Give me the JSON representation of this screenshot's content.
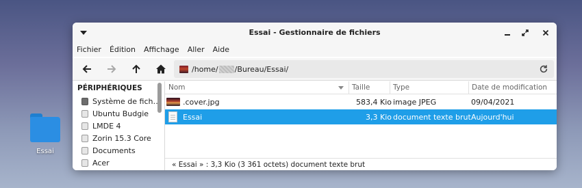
{
  "desktop": {
    "icon_label": "Essai"
  },
  "window": {
    "title": "Essai - Gestionnaire de fichiers"
  },
  "menu": [
    "Fichier",
    "Édition",
    "Affichage",
    "Aller",
    "Aide"
  ],
  "toolbar": {
    "back_icon": "arrow-left-icon",
    "forward_icon": "arrow-right-icon",
    "up_icon": "arrow-up-icon",
    "home_icon": "home-icon"
  },
  "location": {
    "path_prefix": "/home/",
    "path_suffix": "/Bureau/Essai/"
  },
  "sidebar": {
    "header": "PÉRIPHÉRIQUES",
    "items": [
      {
        "label": "Système de fich…",
        "icon": "system-drive-icon"
      },
      {
        "label": "Ubuntu Budgie",
        "icon": "drive-icon"
      },
      {
        "label": "LMDE 4",
        "icon": "drive-icon"
      },
      {
        "label": "Zorin 15.3 Core",
        "icon": "drive-icon"
      },
      {
        "label": "Documents",
        "icon": "drive-icon"
      },
      {
        "label": "Acer",
        "icon": "drive-icon"
      }
    ]
  },
  "columns": {
    "name": "Nom",
    "size": "Taille",
    "type": "Type",
    "date": "Date de modification"
  },
  "files": [
    {
      "name": ".cover.jpg",
      "size": "583,4 Kio",
      "type": "image JPEG",
      "date": "09/04/2021",
      "selected": false
    },
    {
      "name": "Essai",
      "size": "3,3 Kio",
      "type": "document texte brut",
      "date": "Aujourd'hui",
      "selected": true
    }
  ],
  "status": "« Essai » : 3,3 Kio (3 361 octets) document texte brut",
  "colors": {
    "selection": "#1f9ee8",
    "folder": "#2b8ee3"
  }
}
